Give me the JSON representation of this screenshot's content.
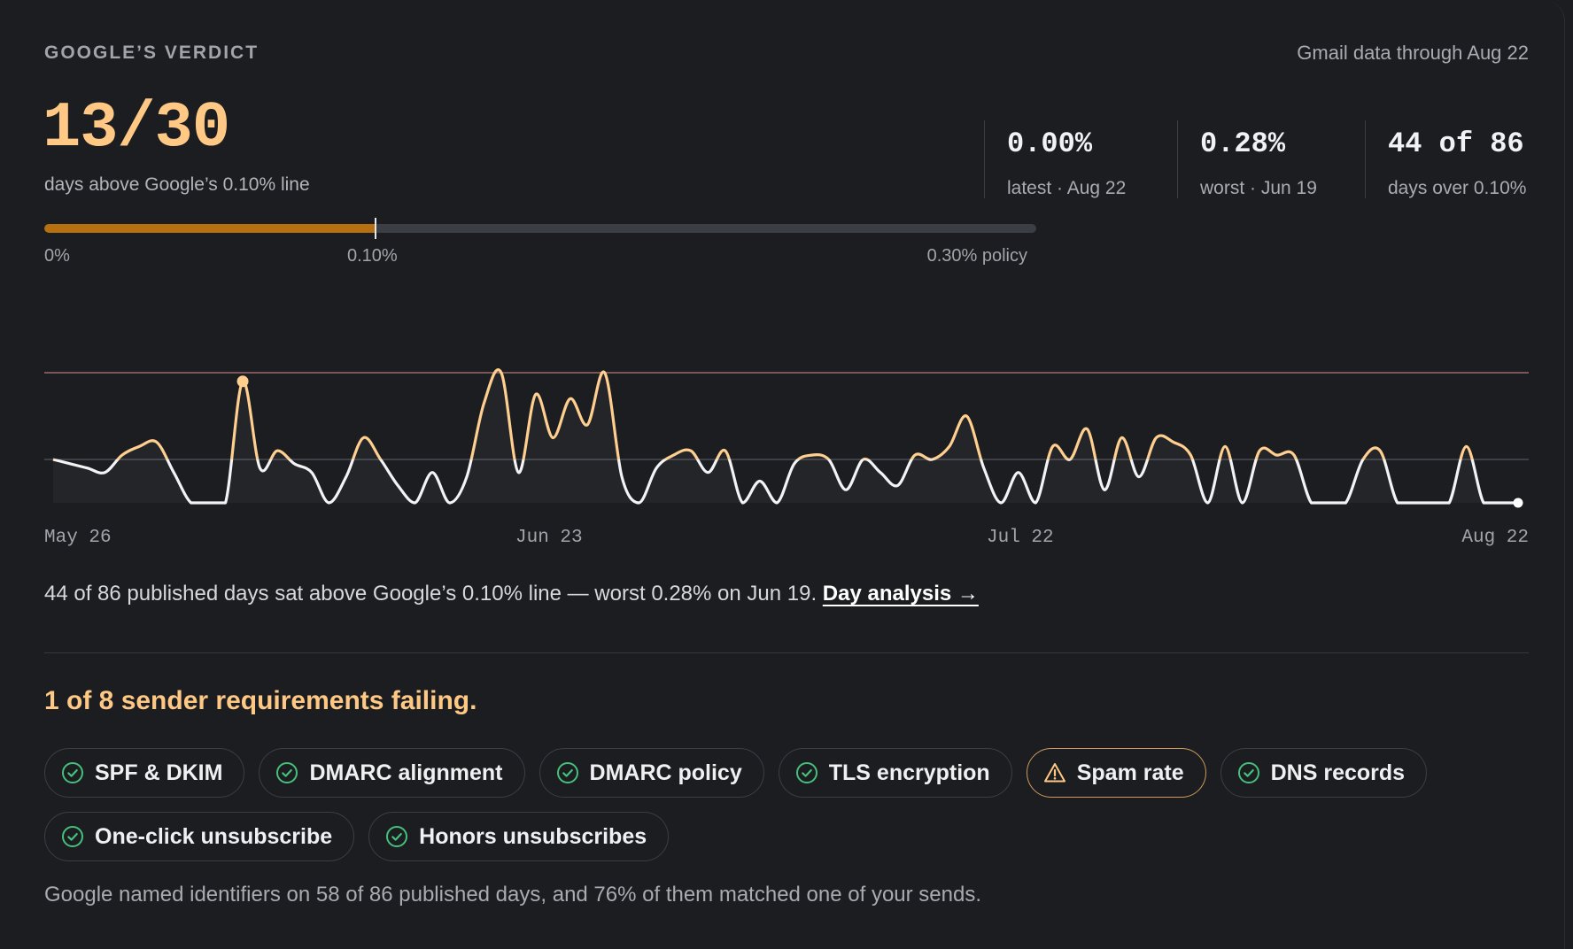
{
  "header": {
    "section_label": "GOOGLE’S VERDICT",
    "data_through": "Gmail data through Aug 22"
  },
  "score": {
    "value": "13/30",
    "subtitle": "days above Google’s 0.10% line"
  },
  "stats": [
    {
      "value": "0.00%",
      "label": "latest · Aug 22"
    },
    {
      "value": "0.28%",
      "label": "worst · Jun 19"
    },
    {
      "value": "44 of 86",
      "label": "days over 0.10%"
    }
  ],
  "threshold_bar": {
    "fill_fraction": 0.3333,
    "ticks": [
      "0%",
      "0.10%",
      "0.30% policy"
    ]
  },
  "chart_data": {
    "type": "line",
    "x_tick_labels": [
      "May 26",
      "Jun 23",
      "Jul 22",
      "Aug 22"
    ],
    "series": [
      {
        "values": [
          0.1,
          0.09,
          0.08,
          0.07,
          0.11,
          0.13,
          0.14,
          0.07,
          0.0,
          0.0,
          0.0,
          0.28,
          0.08,
          0.12,
          0.09,
          0.07,
          0.0,
          0.06,
          0.15,
          0.1,
          0.04,
          0.0,
          0.07,
          0.0,
          0.06,
          0.23,
          0.3,
          0.07,
          0.25,
          0.15,
          0.24,
          0.18,
          0.3,
          0.06,
          0.0,
          0.08,
          0.11,
          0.12,
          0.07,
          0.12,
          0.0,
          0.05,
          0.0,
          0.09,
          0.11,
          0.1,
          0.03,
          0.1,
          0.07,
          0.04,
          0.11,
          0.1,
          0.13,
          0.2,
          0.08,
          0.0,
          0.07,
          0.0,
          0.13,
          0.1,
          0.17,
          0.03,
          0.15,
          0.06,
          0.15,
          0.14,
          0.11,
          0.0,
          0.13,
          0.0,
          0.12,
          0.11,
          0.11,
          0.0,
          0.0,
          0.0,
          0.1,
          0.12,
          0.0,
          0.0,
          0.0,
          0.0,
          0.13,
          0.0,
          0.0,
          0.0
        ],
        "color": "#ffcf8f"
      }
    ],
    "threshold": 0.1,
    "policy_limit": 0.3,
    "ylim": [
      0,
      0.3
    ],
    "highlight_point": {
      "label": "Jun 19",
      "value": 0.28
    },
    "grid": false
  },
  "summary": {
    "text": "44 of 86 published days sat above Google’s 0.10% line — worst 0.28% on Jun 19. ",
    "link": "Day analysis →"
  },
  "requirements": {
    "heading": "1 of 8 sender requirements failing.",
    "items": [
      {
        "label": "SPF & DKIM",
        "status": "pass",
        "icon": "check-circle-icon"
      },
      {
        "label": "DMARC alignment",
        "status": "pass",
        "icon": "check-circle-icon"
      },
      {
        "label": "DMARC policy",
        "status": "pass",
        "icon": "check-circle-icon"
      },
      {
        "label": "TLS encryption",
        "status": "pass",
        "icon": "check-circle-icon"
      },
      {
        "label": "Spam rate",
        "status": "warn",
        "icon": "warning-triangle-icon"
      },
      {
        "label": "DNS records",
        "status": "pass",
        "icon": "check-circle-icon"
      },
      {
        "label": "One-click unsubscribe",
        "status": "pass",
        "icon": "check-circle-icon"
      },
      {
        "label": "Honors unsubscribes",
        "status": "pass",
        "icon": "check-circle-icon"
      }
    ],
    "footer": "Google named identifiers on 58 of 86 published days, and 76% of them matched one of your sends."
  },
  "colors": {
    "accent": "#ffc985",
    "bar_fill": "#b7700f",
    "pass_icon": "#46c07b",
    "warn_border": "#cf9a5a",
    "policy_line": "#9a6b6b"
  }
}
